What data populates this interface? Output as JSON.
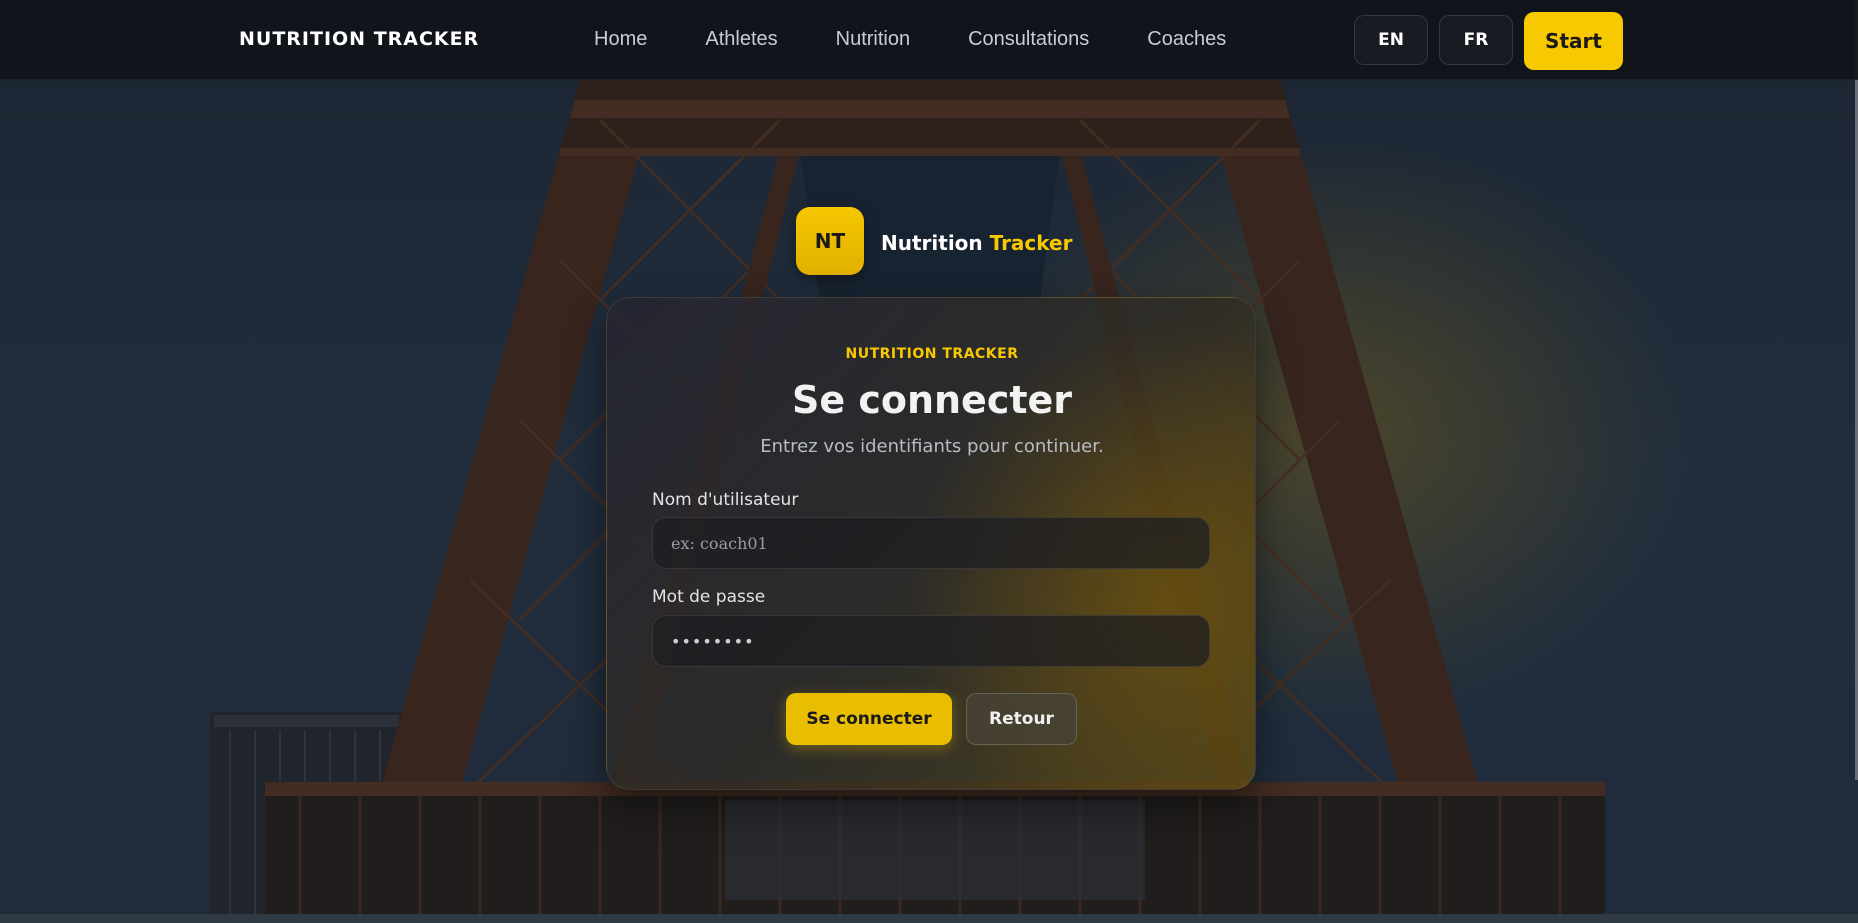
{
  "navbar": {
    "brand": "NUTRITION TRACKER",
    "links": [
      "Home",
      "Athletes",
      "Nutrition",
      "Consultations",
      "Coaches"
    ],
    "lang_en": "EN",
    "lang_fr": "FR",
    "start_label": "Start"
  },
  "logo": {
    "badge": "NT",
    "name_part1": "Nutrition",
    "name_part2": "Tracker"
  },
  "login_card": {
    "kicker": "NUTRITION TRACKER",
    "title": "Se connecter",
    "subtitle": "Entrez vos identifiants pour continuer.",
    "username_label": "Nom d'utilisateur",
    "username_placeholder": "ex: coach01",
    "username_value": "",
    "password_label": "Mot de passe",
    "password_value": "••••••••",
    "submit_label": "Se connecter",
    "back_label": "Retour"
  },
  "colors": {
    "accent": "#f8c900",
    "navbar_bg": "#10141a",
    "card_bg": "#2a2a32"
  },
  "background": {
    "description_icon": "eiffel-tower-image"
  }
}
